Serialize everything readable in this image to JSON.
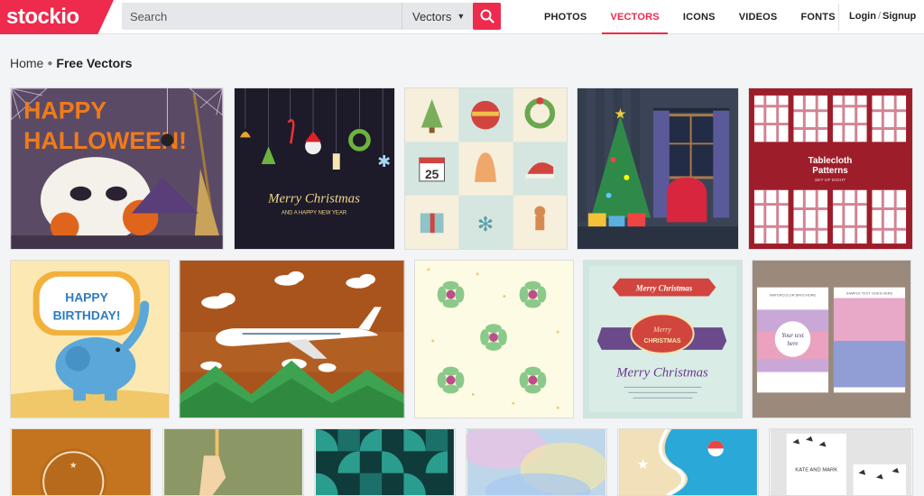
{
  "brand": {
    "logo_text": "stockio"
  },
  "search": {
    "placeholder": "Search",
    "type_label": "Vectors"
  },
  "nav": {
    "items": [
      {
        "label": "PHOTOS"
      },
      {
        "label": "VECTORS"
      },
      {
        "label": "ICONS"
      },
      {
        "label": "VIDEOS"
      },
      {
        "label": "FONTS"
      }
    ],
    "active": "VECTORS",
    "login": "Login",
    "signup": "Signup"
  },
  "breadcrumb": {
    "home": "Home",
    "current": "Free Vectors"
  },
  "colors": {
    "accent": "#ee2a4d"
  },
  "tiles": {
    "halloween": {
      "line1": "HAPPY",
      "line2": "HALLOWEEN!"
    },
    "christmas_dark": {
      "title": "Merry Christmas",
      "subtitle": "AND A HAPPY NEW YEAR"
    },
    "christmas_icons": {
      "calendar_day": "25"
    },
    "tablecloth": {
      "title": "Tablecloth",
      "title2": "Patterns",
      "subtitle": "SET OF EIGHT"
    },
    "birthday": {
      "line1": "HAPPY",
      "line2": "BIRTHDAY!"
    },
    "christmas_ribbons": {
      "ribbon": "Merry Christmas",
      "badge1": "Merry",
      "badge2": "CHRISTMAS",
      "title": "Merry Christmas"
    },
    "watercolor": {
      "label_left": "WATERCOLOR BROCHURE",
      "label_right": "SAMPLE TEXT GOES HERE",
      "center1": "Your text",
      "center2": "here"
    },
    "wedding": {
      "names": "KATE AND MARK"
    }
  }
}
